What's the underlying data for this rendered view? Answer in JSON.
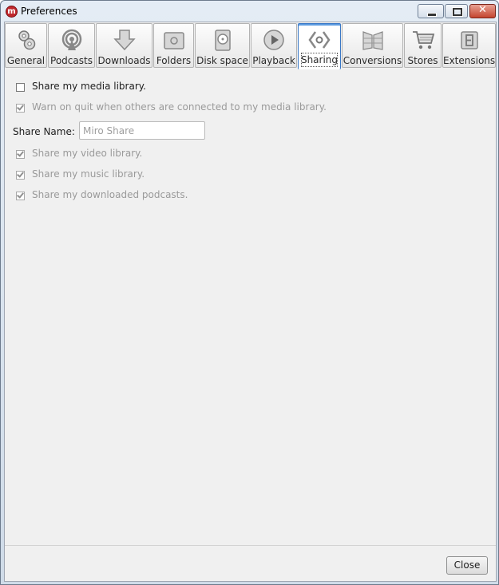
{
  "window": {
    "title": "Preferences",
    "app_icon_letter": "m",
    "close_glyph": "✕"
  },
  "tabs": [
    {
      "label": "General",
      "icon": "gears-icon"
    },
    {
      "label": "Podcasts",
      "icon": "podcast-icon"
    },
    {
      "label": "Downloads",
      "icon": "download-arrow-icon"
    },
    {
      "label": "Folders",
      "icon": "folder-icon"
    },
    {
      "label": "Disk space",
      "icon": "hard-disk-icon"
    },
    {
      "label": "Playback",
      "icon": "play-icon"
    },
    {
      "label": "Sharing",
      "icon": "sharing-icon",
      "active": true
    },
    {
      "label": "Conversions",
      "icon": "conversions-icon"
    },
    {
      "label": "Stores",
      "icon": "shopping-cart-icon"
    },
    {
      "label": "Extensions",
      "icon": "extensions-icon"
    }
  ],
  "sharing": {
    "share_library": {
      "label": "Share my media library.",
      "checked": false,
      "enabled": true
    },
    "warn_on_quit": {
      "label": "Warn on quit when others are connected to my media library.",
      "checked": true,
      "enabled": false
    },
    "share_name": {
      "label": "Share Name:",
      "value": "Miro Share",
      "enabled": false
    },
    "share_video": {
      "label": "Share my video library.",
      "checked": true,
      "enabled": false
    },
    "share_music": {
      "label": "Share my music library.",
      "checked": true,
      "enabled": false
    },
    "share_podcasts": {
      "label": "Share my downloaded podcasts.",
      "checked": true,
      "enabled": false
    }
  },
  "footer": {
    "close_label": "Close"
  }
}
